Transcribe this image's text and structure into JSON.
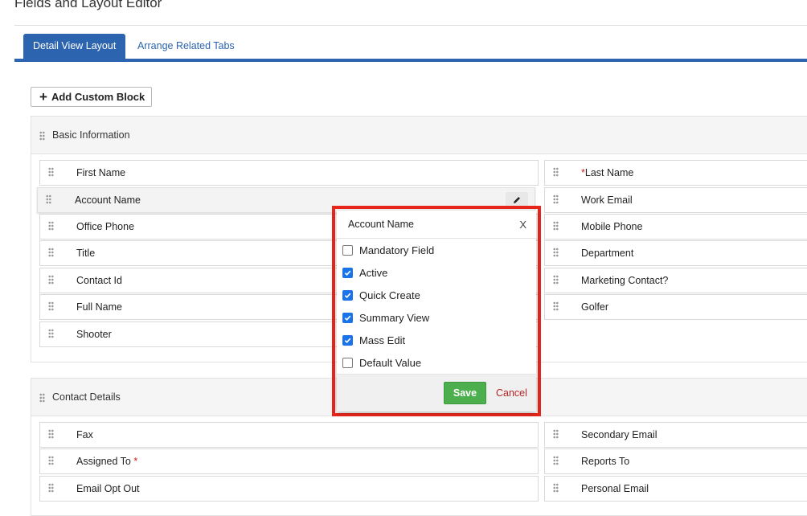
{
  "page": {
    "title": "Fields and Layout Editor"
  },
  "tabs": [
    {
      "label": "Detail View Layout",
      "active": true
    },
    {
      "label": "Arrange Related Tabs",
      "active": false
    }
  ],
  "toolbar": {
    "add_custom_block_label": "Add Custom Block"
  },
  "blocks": {
    "basic": {
      "title": "Basic Information",
      "left_fields": [
        "First Name",
        "Account Name",
        "Office Phone",
        "Title",
        "Contact Id",
        "Full Name",
        "Shooter"
      ],
      "right_fields": [
        "Last Name",
        "Work Email",
        "Mobile Phone",
        "Department",
        "Marketing Contact?",
        "Golfer"
      ]
    },
    "contact": {
      "title": "Contact Details",
      "left_fields": [
        "Fax",
        "Assigned To",
        "Email Opt Out"
      ],
      "right_fields": [
        "Secondary Email",
        "Reports To",
        "Personal Email"
      ]
    }
  },
  "required_marker": "*",
  "popup": {
    "title": "Account Name",
    "close_label": "X",
    "options": [
      {
        "label": "Mandatory Field",
        "checked": false
      },
      {
        "label": "Active",
        "checked": true
      },
      {
        "label": "Quick Create",
        "checked": true
      },
      {
        "label": "Summary View",
        "checked": true
      },
      {
        "label": "Mass Edit",
        "checked": true
      },
      {
        "label": "Default Value",
        "checked": false
      }
    ],
    "save_label": "Save",
    "cancel_label": "Cancel"
  },
  "colors": {
    "accent": "#2c64b0",
    "save": "#4cae4c",
    "cancel": "#b62424",
    "highlight": "#e8261b",
    "required": "#d42020"
  }
}
